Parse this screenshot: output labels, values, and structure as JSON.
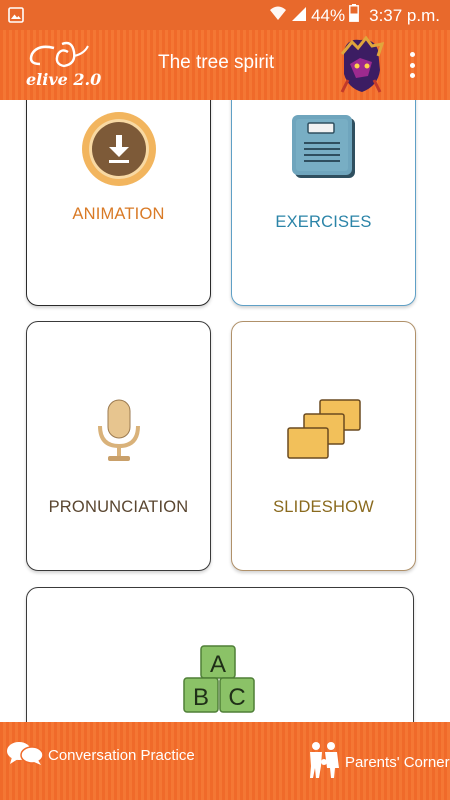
{
  "status_bar": {
    "battery_percent": "44%",
    "time": "3:37 p.m."
  },
  "app_bar": {
    "logo_text": "elive 2.0",
    "title": "The tree spirit"
  },
  "cards": {
    "animation": {
      "label": "ANIMATION",
      "color": "#d97a26"
    },
    "exercises": {
      "label": "EXERCISES",
      "color": "#2b84a8"
    },
    "pronunciation": {
      "label": "PRONUNCIATION",
      "color": "#5a4630"
    },
    "slideshow": {
      "label": "SLIDESHOW",
      "color": "#8a6a1e"
    },
    "abc": {
      "letters": [
        "A",
        "B",
        "C"
      ]
    }
  },
  "bottom_bar": {
    "conversation_label": "Conversation Practice",
    "parents_label": "Parents' Corner"
  },
  "colors": {
    "brand_orange": "#f06a2a"
  },
  "icons": {
    "status": [
      "gallery-icon",
      "wifi-icon",
      "signal-icon",
      "battery-icon"
    ],
    "app_bar": [
      "elive-logo",
      "avatar",
      "overflow-menu-icon"
    ],
    "cards": [
      "download-icon",
      "notebook-icon",
      "microphone-icon",
      "slides-icon",
      "abc-blocks-icon"
    ],
    "bottom": [
      "chat-bubbles-icon",
      "family-icon"
    ]
  }
}
